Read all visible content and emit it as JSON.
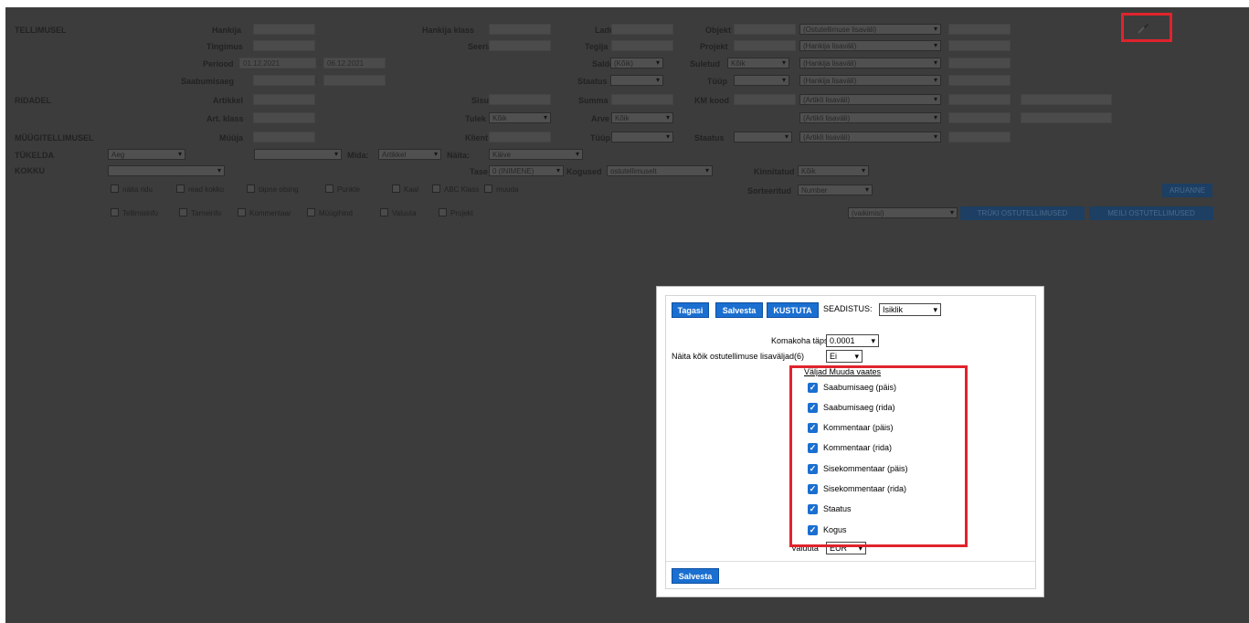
{
  "sections": {
    "tellimusel": "TELLIMUSEL",
    "ridadel": "RIDADEL",
    "myygitellimusel": "MÜÜGITELLIMUSEL",
    "tykelda": "TÜKELDA",
    "kokku": "KOKKU"
  },
  "labels": {
    "hankija": "Hankija",
    "hankija_klass": "Hankija klass",
    "ladu": "Ladu",
    "objekt": "Objekt",
    "tingimus": "Tingimus",
    "seeria": "Seeria",
    "tegija": "Tegija",
    "projekt": "Projekt",
    "periood": "Periood",
    "saldo": "Saldo",
    "suletud": "Suletud",
    "saabumisaeg": "Saabumisaeg",
    "staatus": "Staatus",
    "tyyp": "Tüüp",
    "artikkel": "Artikkel",
    "sisu": "Sisu",
    "summa": "Summa",
    "km_kood": "KM kood",
    "art_klass": "Art. klass",
    "tulek": "Tulek",
    "arve": "Arve",
    "myyja": "Müüja",
    "klient": "Klient",
    "tyyp2": "Tüüp",
    "staatus2": "Staatus",
    "mida": "Mida:",
    "naita": "Näita:",
    "tase": "Tase",
    "kogused": "Kogused",
    "kinnitatud": "Kinnitatud",
    "sorteeritud": "Sorteeritud"
  },
  "values": {
    "period_from": "01.12.2021",
    "period_to": "06.12.2021",
    "period_sep": ":",
    "saab_sep": ":",
    "saldo": "(Kõik)",
    "suletud": "Kõik",
    "tulek": "Kõik",
    "arve": "Kõik",
    "tykelda": "Aeg",
    "mida": "Artikkel",
    "naita": "Käive",
    "tase": "0 (INIMENE)",
    "kogused": "ostutellimuselt",
    "kinnitatud": "Kõik",
    "sorteeritud": "Number",
    "vaikimisi": "(vaikimisi)",
    "ostu_lisavali": "(Ostutellimuse lisaväli)",
    "hankija_lisavali": "(Hankija lisaväli)",
    "artikli_lisavali": "(Artikli lisaväli)"
  },
  "checkboxes_row1": [
    "näita ridu",
    "read kokku",
    "täpne otsing",
    "Punkte",
    "Kaal",
    "ABC Klass",
    "muuda"
  ],
  "checkboxes_row2": [
    "Tellimisinfo",
    "Tarneinfo",
    "Kommentaar",
    "Müügihind",
    "Valuuta",
    "Projekt"
  ],
  "buttons": {
    "aruanne": "ARUANNE",
    "tryki": "TRÜKI OSTUTELLIMUSED",
    "meili": "MEILI OSTUTELLIMUSED"
  },
  "dialog": {
    "tagasi": "Tagasi",
    "salvesta": "Salvesta",
    "kustuta": "KUSTUTA",
    "seadistus_label": "SEADISTUS:",
    "seadistus_value": "Isiklik",
    "komakoha_label": "Komakoha täpsus",
    "komakoha_value": "0.0001",
    "naita_label": "Näita kõik ostutellimuse lisaväljad(6)",
    "naita_value": "Ei",
    "valjad_header": "Väljad Muuda vaates",
    "fields": [
      "Saabumisaeg (päis)",
      "Saabumisaeg (rida)",
      "Kommentaar (päis)",
      "Kommentaar (rida)",
      "Sisekommentaar (päis)",
      "Sisekommentaar (rida)",
      "Staatus",
      "Kogus"
    ],
    "valuuta_label": "Valuuta",
    "valuuta_value": "EUR",
    "salvesta_bottom": "Salvesta"
  },
  "colors": {
    "accent": "#1a6fd0",
    "highlight": "#e0232c",
    "overlay": "#3c3c3c"
  },
  "icons": {
    "settings": "wrench-icon"
  }
}
